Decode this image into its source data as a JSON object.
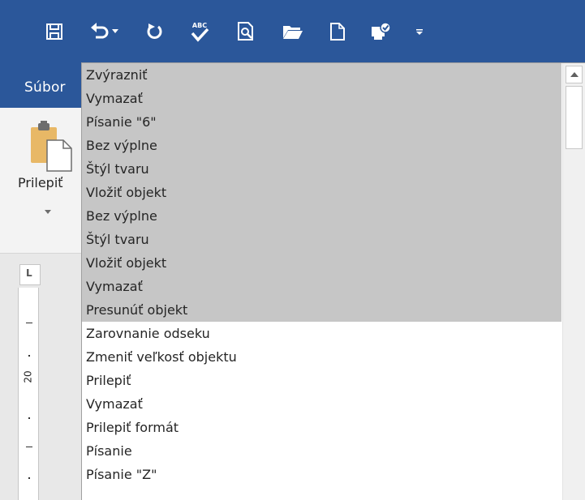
{
  "toolbar": {
    "background": "#2b579a",
    "icons": [
      "save-icon",
      "undo-icon",
      "undo-dropdown-icon",
      "redo-icon",
      "spelling-check-icon",
      "print-preview-icon",
      "open-icon",
      "new-document-icon",
      "check-out-icon",
      "customize-toolbar-icon"
    ],
    "spelling_badge": "ABC"
  },
  "ribbon": {
    "file_tab_label": "Súbor",
    "paste_label": "Prilepiť"
  },
  "ruler": {
    "tab_selector_glyph": "L",
    "number_label": "20"
  },
  "undo_list": {
    "selected_color": "#c6c6c6",
    "items": [
      {
        "label": "Zvýrazniť",
        "selected": true
      },
      {
        "label": "Vymazať",
        "selected": true
      },
      {
        "label": "Písanie \"6\"",
        "selected": true
      },
      {
        "label": "Bez výplne",
        "selected": true
      },
      {
        "label": "Štýl tvaru",
        "selected": true
      },
      {
        "label": "Vložiť objekt",
        "selected": true
      },
      {
        "label": "Bez výplne",
        "selected": true
      },
      {
        "label": "Štýl tvaru",
        "selected": true
      },
      {
        "label": "Vložiť objekt",
        "selected": true
      },
      {
        "label": "Vymazať",
        "selected": true
      },
      {
        "label": "Presunúť objekt",
        "selected": true
      },
      {
        "label": "Zarovnanie odseku",
        "selected": false
      },
      {
        "label": "Zmeniť veľkosť objektu",
        "selected": false
      },
      {
        "label": "Prilepiť",
        "selected": false
      },
      {
        "label": "Vymazať",
        "selected": false
      },
      {
        "label": "Prilepiť formát",
        "selected": false
      },
      {
        "label": "Písanie",
        "selected": false
      },
      {
        "label": "Písanie \"Z\"",
        "selected": false
      }
    ]
  }
}
